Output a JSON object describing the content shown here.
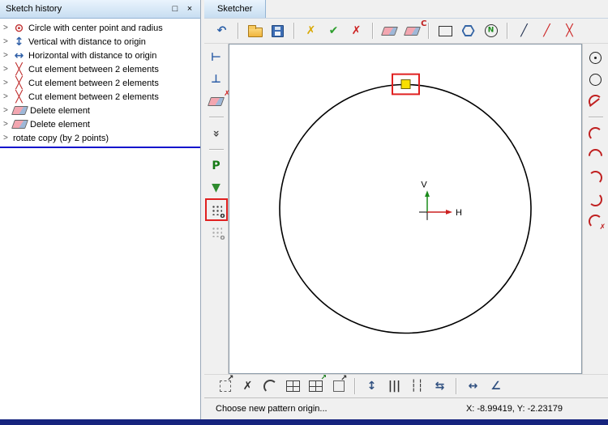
{
  "colors": {
    "highlight_red": "#e02020",
    "insert_line_blue": "#1515cc",
    "handle_yellow": "#f8df00",
    "titlebar_blue": "#c7ddf1",
    "bottom_strip_navy": "#16247e"
  },
  "left_panel": {
    "title": "Sketch history",
    "window_buttons": {
      "maximize": "□",
      "close": "×"
    },
    "items": [
      {
        "icon": "circle-radius-icon",
        "g": "⊙",
        "c": "#c03030",
        "label": "Circle with center point and radius"
      },
      {
        "icon": "vertical-distance-icon",
        "g": "↕",
        "c": "#3060a8",
        "label": "Vertical with distance to origin"
      },
      {
        "icon": "horizontal-distance-icon",
        "g": "↔",
        "c": "#3060a8",
        "label": "Horizontal with distance to origin"
      },
      {
        "icon": "cut-element-icon",
        "g": "╳",
        "c": "#c03030",
        "label": "Cut element between 2 elements"
      },
      {
        "icon": "cut-element-icon",
        "g": "╳",
        "c": "#c03030",
        "label": "Cut element between 2 elements"
      },
      {
        "icon": "cut-element-icon",
        "g": "╳",
        "c": "#c03030",
        "label": "Cut element between 2 elements"
      },
      {
        "icon": "delete-element-icon",
        "shape": "eraser",
        "label": "Delete element"
      },
      {
        "icon": "delete-element-icon",
        "shape": "eraser",
        "label": "Delete element"
      },
      {
        "icon": "",
        "label": "rotate copy (by 2 points)"
      }
    ]
  },
  "sketcher": {
    "title": "Sketcher",
    "top_toolbar": [
      {
        "name": "undo-icon",
        "g": "↶",
        "c": "#2b5fa8"
      },
      {
        "sep": true
      },
      {
        "name": "open-file-icon",
        "shape": "folder"
      },
      {
        "name": "save-file-icon",
        "shape": "floppy"
      },
      {
        "sep": true
      },
      {
        "name": "delete-all-icon",
        "g": "✗",
        "c": "#d9a800"
      },
      {
        "name": "accept-sketch-icon",
        "g": "✔",
        "c": "#2e9e2e"
      },
      {
        "name": "cancel-sketch-icon",
        "g": "✗",
        "c": "#cc2020"
      },
      {
        "sep": true
      },
      {
        "name": "erase-element-icon",
        "shape": "eraser"
      },
      {
        "name": "erase-constraints-icon",
        "shape": "eraser eraserc"
      },
      {
        "sep": true
      },
      {
        "name": "rectangle-tool-icon",
        "shape": "rectsh"
      },
      {
        "name": "polygon-tool-icon",
        "shape": "hex"
      },
      {
        "name": "ngon-tool-icon",
        "shape": "ncircle"
      },
      {
        "sep": true
      },
      {
        "name": "line-tool-icon",
        "g": "╱",
        "c": "#203050"
      },
      {
        "name": "construction-line-icon",
        "g": "╱",
        "c": "#cc2020"
      },
      {
        "name": "delete-line-icon",
        "g": "╳",
        "c": "#cc2020"
      }
    ],
    "left_toolbar": [
      {
        "name": "trim-extend-icon",
        "g": "⊢",
        "c": "#3060a8"
      },
      {
        "name": "trim-point-icon",
        "g": "⊥",
        "c": "#3060a8"
      },
      {
        "name": "erase-selected-icon",
        "shape": "eraser eraserx"
      },
      {
        "sep": true
      },
      {
        "name": "collapse-toolbar-icon",
        "g": "»",
        "rot": 90,
        "c": "#404040"
      },
      {
        "sep": true
      },
      {
        "name": "insert-point-icon",
        "g": "P",
        "c": "#157a15"
      },
      {
        "name": "pattern-direction-icon",
        "g": "▼",
        "c": "#2e8b2e"
      },
      {
        "name": "pattern-origin-icon",
        "shape": "grid",
        "hl": true
      },
      {
        "name": "pattern-origin-alt-icon",
        "shape": "grid grid2"
      }
    ],
    "right_toolbar": [
      {
        "name": "circle-center-point-icon",
        "shape": "circle circledot"
      },
      {
        "name": "circle-tool-icon",
        "shape": "circle"
      },
      {
        "name": "arc-tangent-icon",
        "shape": "arc arcline"
      },
      {
        "sep": true
      },
      {
        "name": "arc-3-points-icon",
        "shape": "arc"
      },
      {
        "name": "arc-center-radius-icon",
        "shape": "arc",
        "rot": 45
      },
      {
        "name": "arc-endpoints-icon",
        "shape": "arc",
        "rot": 90
      },
      {
        "name": "arc-angle-icon",
        "shape": "arc",
        "rot": 180
      },
      {
        "name": "delete-arc-icon",
        "shape": "arc arcx"
      }
    ],
    "bottom_toolbar": [
      {
        "name": "move-pattern-icon",
        "shape": "boxarrow"
      },
      {
        "name": "delete-pattern-icon",
        "g": "✗",
        "c": "#303030"
      },
      {
        "name": "measure-arc-icon",
        "shape": "arc",
        "c": "#404040"
      },
      {
        "name": "pattern-grid-icon",
        "shape": "gridsq"
      },
      {
        "name": "pattern-grid-move-icon",
        "shape": "gridsq gridsq2"
      },
      {
        "name": "scale-pattern-icon",
        "shape": "boxarrow boxarrow2"
      },
      {
        "sep": true
      },
      {
        "name": "vertical-dimension-icon",
        "g": "↕",
        "c": "#305080"
      },
      {
        "name": "parallel-lines-icon",
        "g": "|||",
        "c": "#303030"
      },
      {
        "name": "dotted-lines-icon",
        "g": "┆┆",
        "c": "#303030"
      },
      {
        "name": "stacked-dimension-icon",
        "g": "⇆",
        "c": "#305080"
      },
      {
        "sep": true
      },
      {
        "name": "horizontal-dimension-icon",
        "g": "↔",
        "c": "#305080"
      },
      {
        "name": "angle-dimension-icon",
        "g": "∠",
        "c": "#305080"
      }
    ],
    "canvas": {
      "axis_labels": {
        "v": "V",
        "h": "H"
      }
    },
    "statusbar": {
      "message": "Choose new pattern origin...",
      "coordinates": "X: -8.99419, Y: -2.23179"
    }
  }
}
